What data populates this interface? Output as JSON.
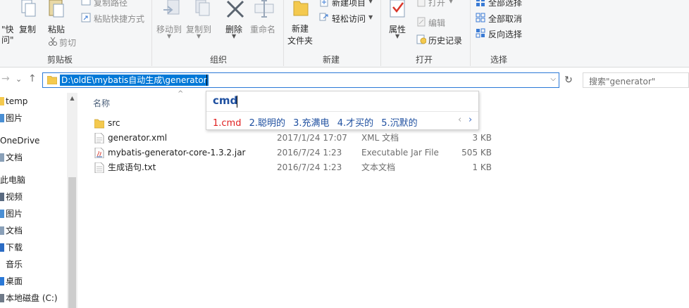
{
  "ribbon": {
    "clipboard": {
      "quick_access_partial": "\"快",
      "quick_access_partial2": "问\"",
      "copy_label": "复制",
      "paste_label": "粘贴",
      "copy_path_label": "复制路径",
      "paste_shortcut_label": "粘贴快捷方式",
      "cut_label": "剪切",
      "group_label": "剪贴板"
    },
    "organize": {
      "move_to_label": "移动到",
      "copy_to_label": "复制到",
      "delete_label": "删除",
      "rename_label": "重命名",
      "group_label": "组织"
    },
    "new": {
      "new_folder_label_1": "新建",
      "new_folder_label_2": "文件夹",
      "new_item_label": "新建项目",
      "easy_access_label": "轻松访问",
      "group_label": "新建"
    },
    "open": {
      "properties_label": "属性",
      "open_label": "打开",
      "edit_label": "编辑",
      "history_label": "历史记录",
      "group_label": "打开"
    },
    "select": {
      "select_all_label": "全部选择",
      "select_none_label": "全部取消",
      "invert_label": "反向选择",
      "group_label": "选择"
    }
  },
  "address": {
    "path": "D:\\oldE\\mybatis自动生成\\generator",
    "search_placeholder": "搜索\"generator\""
  },
  "nav_pane": {
    "items": [
      {
        "label": "temp",
        "icon": "folder-icon"
      },
      {
        "label": "图片",
        "icon": "pictures-icon"
      },
      {
        "label": "OneDrive",
        "icon": "cloud-icon"
      },
      {
        "label": "文档",
        "icon": "documents-icon"
      },
      {
        "label": "此电脑",
        "icon": "computer-icon"
      },
      {
        "label": "视频",
        "icon": "videos-icon"
      },
      {
        "label": "图片",
        "icon": "pictures-icon"
      },
      {
        "label": "文档",
        "icon": "documents-icon"
      },
      {
        "label": "下载",
        "icon": "downloads-icon"
      },
      {
        "label": "音乐",
        "icon": "music-icon"
      },
      {
        "label": "桌面",
        "icon": "desktop-icon"
      },
      {
        "label": "本地磁盘 (C:)",
        "icon": "drive-icon"
      }
    ]
  },
  "file_list": {
    "header": {
      "name": "名称"
    },
    "rows": [
      {
        "name": "src",
        "date": "",
        "type": "",
        "size": "",
        "icon": "folder-icon"
      },
      {
        "name": "generator.xml",
        "date": "2017/1/24 17:07",
        "type": "XML 文档",
        "size": "3 KB",
        "icon": "xml-file-icon"
      },
      {
        "name": "mybatis-generator-core-1.3.2.jar",
        "date": "2016/7/24 1:23",
        "type": "Executable Jar File",
        "size": "505 KB",
        "icon": "jar-file-icon"
      },
      {
        "name": "生成语句.txt",
        "date": "2016/7/24 1:23",
        "type": "文本文档",
        "size": "1 KB",
        "icon": "text-file-icon"
      }
    ]
  },
  "ime": {
    "input": "cmd",
    "candidates": [
      "1.cmd",
      "2.聪明的",
      "3.充满电",
      "4.才买的",
      "5.沉默的"
    ],
    "selected_index": 0,
    "prev_glyph": "‹",
    "next_glyph": "›"
  },
  "colors": {
    "accent": "#0078d7",
    "ime_text": "#1f50a0",
    "ime_selected": "#e02020",
    "folder": "#f4c94e"
  }
}
